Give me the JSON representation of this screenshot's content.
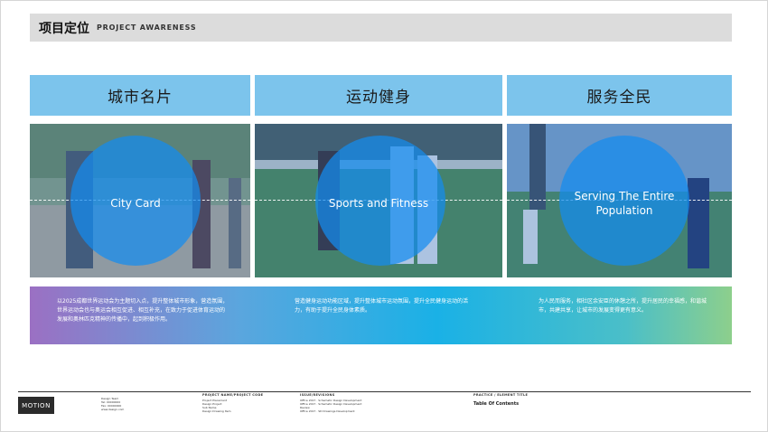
{
  "header": {
    "title_cn": "项目定位",
    "title_en": "PROJECT AWARENESS"
  },
  "columns": [
    {
      "title": "城市名片",
      "caption": "City Card"
    },
    {
      "title": "运动健身",
      "caption": "Sports and Fitness"
    },
    {
      "title": "服务全民",
      "caption": "Serving The Entire Population"
    }
  ],
  "band_texts": [
    "以2025成都世界运动会为主题切入点，提升整体城市形象，营造氛围，世界运动会也与奥运会相互促进、相互补充，在致力于促进体育运动的发展和奥林匹克精神的传播中，起到积极作用。",
    "营造健身运动功能区域，提升整体城市运动氛围，提升全民健身运动的活力，有助于提升全民身体素质。",
    "为人民而服务，相社区余安臣的休憩之所，提升居民的幸福感，和谐城市，共建共享，让城市的发展变得更有意义。"
  ],
  "footer": {
    "logo": "MOTION",
    "contact": [
      "Design Team",
      "Tel: 00000000",
      "Fax: 00000000",
      "www.design.com"
    ],
    "col2_head": "PROJECT NAME/PROJECT CODE",
    "col2": [
      "Project Placement",
      "Design Project",
      "Sub Name",
      "Design Drawing Item"
    ],
    "col3_head": "ISSUE/REVISIONS",
    "col3": [
      "Office 2017 · Schematic Design Development",
      "Office 2017 · Schematic Design Development",
      "Review",
      "Office 2017 · SD Drawings Development"
    ],
    "col4_head": "PRACTICE / ELEMENT TITLE",
    "toc": "Table Of Contents"
  }
}
